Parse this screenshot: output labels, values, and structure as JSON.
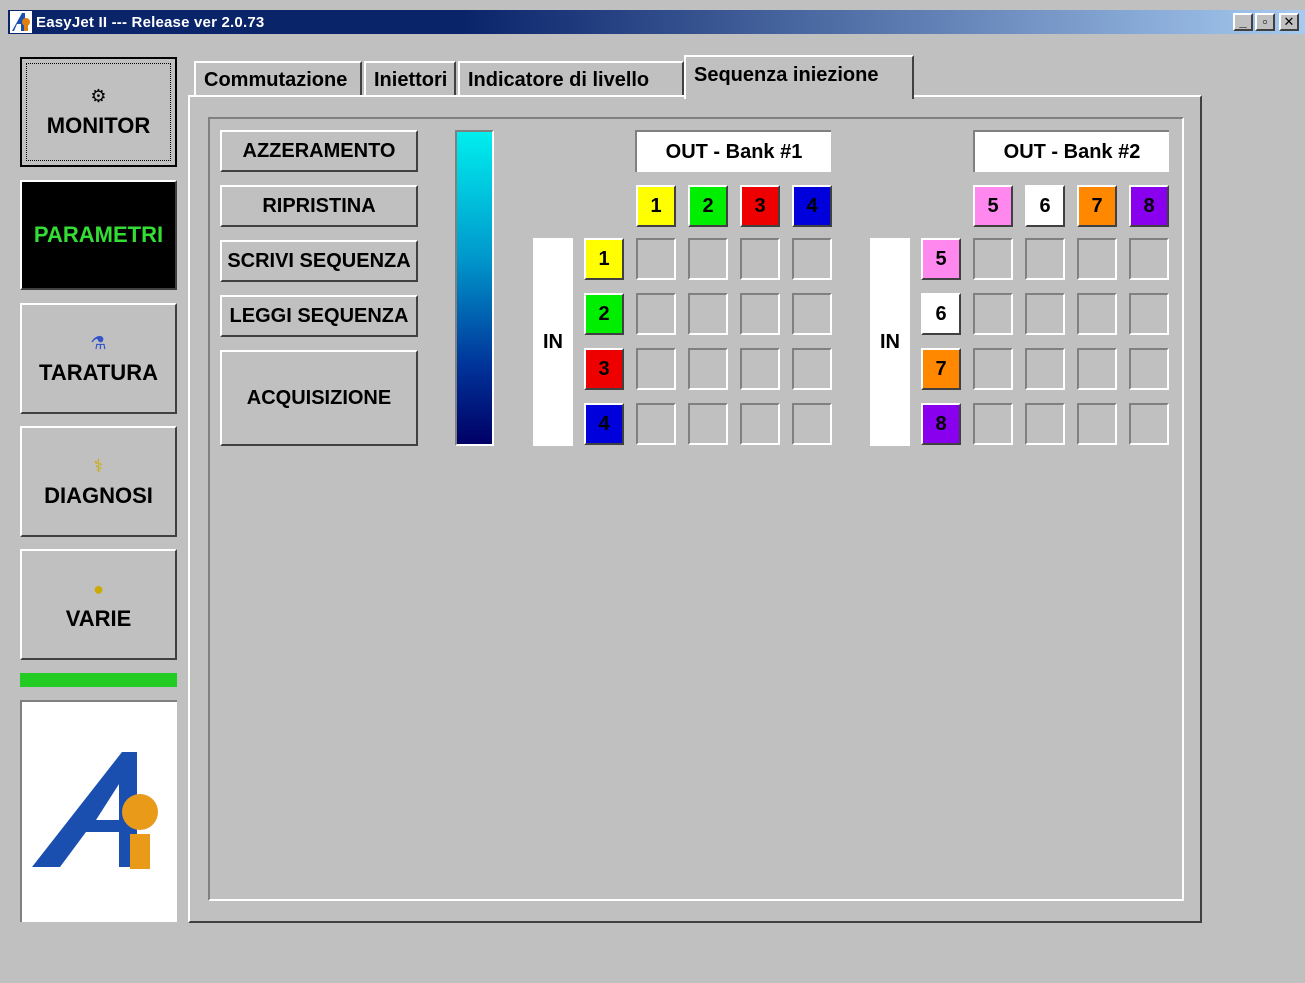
{
  "window": {
    "title": "EasyJet II --- Release ver 2.0.73",
    "controls": {
      "minimize": "_",
      "maximize": "▫",
      "close": "✕"
    }
  },
  "sidebar": {
    "items": [
      {
        "label": "MONITOR",
        "icon": "gear-icon",
        "glyph": "⚙"
      },
      {
        "label": "PARAMETRI",
        "icon": "",
        "glyph": ""
      },
      {
        "label": "TARATURA",
        "icon": "flask-icon",
        "glyph": "⚗"
      },
      {
        "label": "DIAGNOSI",
        "icon": "stethoscope-icon",
        "glyph": "⚕"
      },
      {
        "label": "VARIE",
        "icon": "coin-icon",
        "glyph": "●"
      }
    ],
    "status_color": "#22cc22"
  },
  "tabs": [
    {
      "label": "Commutazione"
    },
    {
      "label": "Iniettori"
    },
    {
      "label": "Indicatore di livello"
    },
    {
      "label": "Sequenza iniezione",
      "active": true
    }
  ],
  "actions": {
    "azzeramento": "AZZERAMENTO",
    "ripristina": "RIPRISTINA",
    "scrivi": "SCRIVI SEQUENZA",
    "leggi": "LEGGI SEQUENZA",
    "acquisizione": "ACQUISIZIONE"
  },
  "bank1": {
    "out_label": "OUT - Bank #1",
    "in_label": "IN",
    "channels": [
      {
        "num": "1",
        "color": "#ffff00",
        "text_color": "#000000"
      },
      {
        "num": "2",
        "color": "#00ee00",
        "text_color": "#000000"
      },
      {
        "num": "3",
        "color": "#ee0000",
        "text_color": "#000000"
      },
      {
        "num": "4",
        "color": "#0000dd",
        "text_color": "#000000"
      }
    ]
  },
  "bank2": {
    "out_label": "OUT - Bank #2",
    "in_label": "IN",
    "channels": [
      {
        "num": "5",
        "color": "#ff88ee",
        "text_color": "#000000"
      },
      {
        "num": "6",
        "color": "#ffffff",
        "text_color": "#000000"
      },
      {
        "num": "7",
        "color": "#ff8800",
        "text_color": "#000000"
      },
      {
        "num": "8",
        "color": "#8800ee",
        "text_color": "#000000"
      }
    ]
  }
}
